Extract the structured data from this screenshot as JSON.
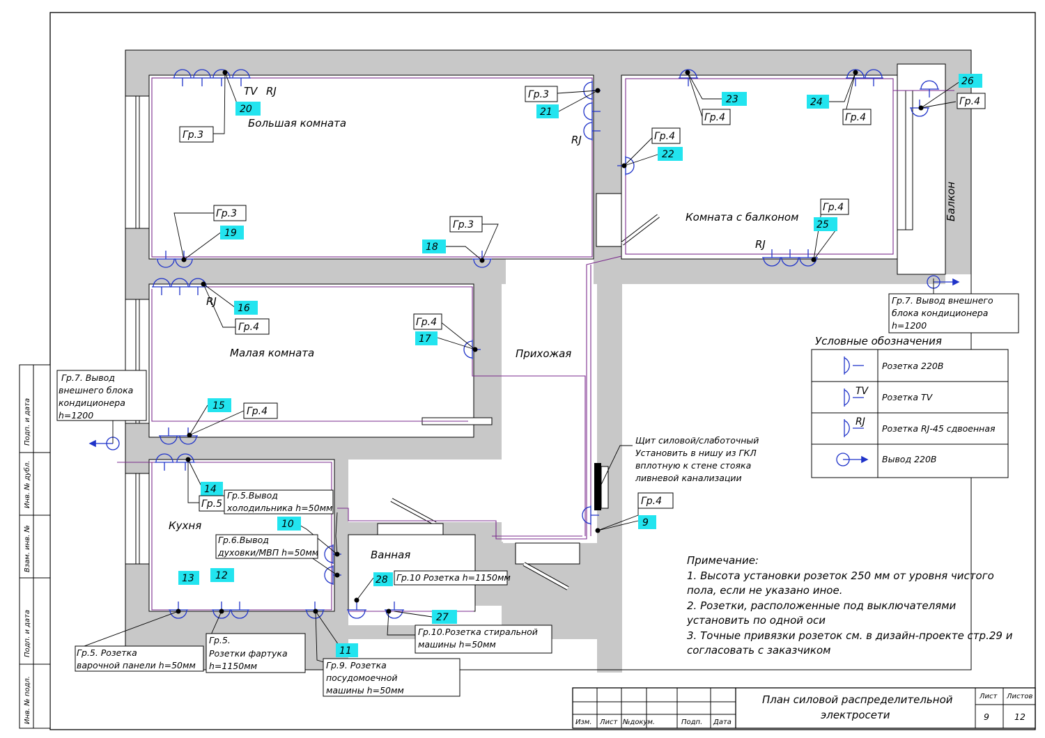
{
  "rooms": {
    "big": "Большая комната",
    "balcony_room": "Комната с балконом",
    "balcony": "Балкон",
    "small": "Малая комната",
    "hall": "Прихожая",
    "kitchen": "Кухня",
    "bath": "Ванная"
  },
  "group_tags": {
    "gr3": "Гр.3",
    "gr4": "Гр.4",
    "gr5": "Гр.5"
  },
  "socket_marks": {
    "tv": "TV",
    "rj": "RJ"
  },
  "numbers": [
    "9",
    "10",
    "11",
    "12",
    "13",
    "14",
    "15",
    "16",
    "17",
    "18",
    "19",
    "20",
    "21",
    "22",
    "23",
    "24",
    "25",
    "26",
    "27",
    "28"
  ],
  "callouts": {
    "ac_left": [
      "Гр.7. Вывод",
      "внешнего блока",
      "кондиционера",
      "h=1200"
    ],
    "ac_right": [
      "Гр.7. Вывод внешнего",
      "блока кондиционера",
      "h=1200"
    ],
    "fridge": [
      "Гр.5.Вывод",
      "холодильника h=50мм"
    ],
    "oven": [
      "Гр.6.Вывод",
      "духовки/МВП h=50мм"
    ],
    "bath_socket": "Гр.10 Розетка h=1150мм",
    "washer": [
      "Гр.10.Розетка стиральной",
      "машины h=50мм"
    ],
    "hob": [
      "Гр.5. Розетка",
      "варочной панели h=50мм"
    ],
    "apron": [
      "Гр.5.",
      "Розетки фартука",
      "h=1150мм"
    ],
    "dishwasher": [
      "Гр.9. Розетка",
      "посудомоечной",
      "машины h=50мм"
    ],
    "panel": [
      "Щит силовой/слаботочный",
      "Установить в нишу из ГКЛ",
      "вплотную к стене стояка",
      "ливневой канализации"
    ]
  },
  "legend": {
    "title": "Условные обозначения",
    "items": [
      {
        "icon": "socket-220v-icon",
        "label": "Розетка 220В"
      },
      {
        "icon": "socket-tv-icon",
        "label": "Розетка TV"
      },
      {
        "icon": "socket-rj45-icon",
        "label": "Розетка RJ-45 сдвоенная"
      },
      {
        "icon": "outlet-220v-icon",
        "label": "Вывод 220В"
      }
    ]
  },
  "notes": {
    "title": "Примечание:",
    "lines": [
      "1. Высота установки  розеток 250 мм от уровня чистого",
      "пола, если не указано иное.",
      "2.  Розетки, расположенные под выключателями",
      "установить по одной оси",
      "3. Точные привязки розеток см. в дизайн-проекте стр.29 и",
      "согласовать с заказчиком"
    ]
  },
  "side_stamp": [
    "Подп. и дата",
    "Инв. № дубл.",
    "Взам. инв. №",
    "Подп. и дата",
    "Инв. № подл."
  ],
  "title_block": {
    "headers": [
      "Изм.",
      "Лист",
      "№докум.",
      "Подп.",
      "Дата"
    ],
    "title": [
      "План силовой распределительной",
      "электросети"
    ],
    "sheet_label": "Лист",
    "sheets_label": "Листов",
    "sheet": "9",
    "sheets": "12"
  },
  "colors": {
    "walls": "#c8c8c8",
    "cable": "#7a2a8c",
    "sockets": "#1f33c9",
    "number_tag": "#22e4ef"
  }
}
